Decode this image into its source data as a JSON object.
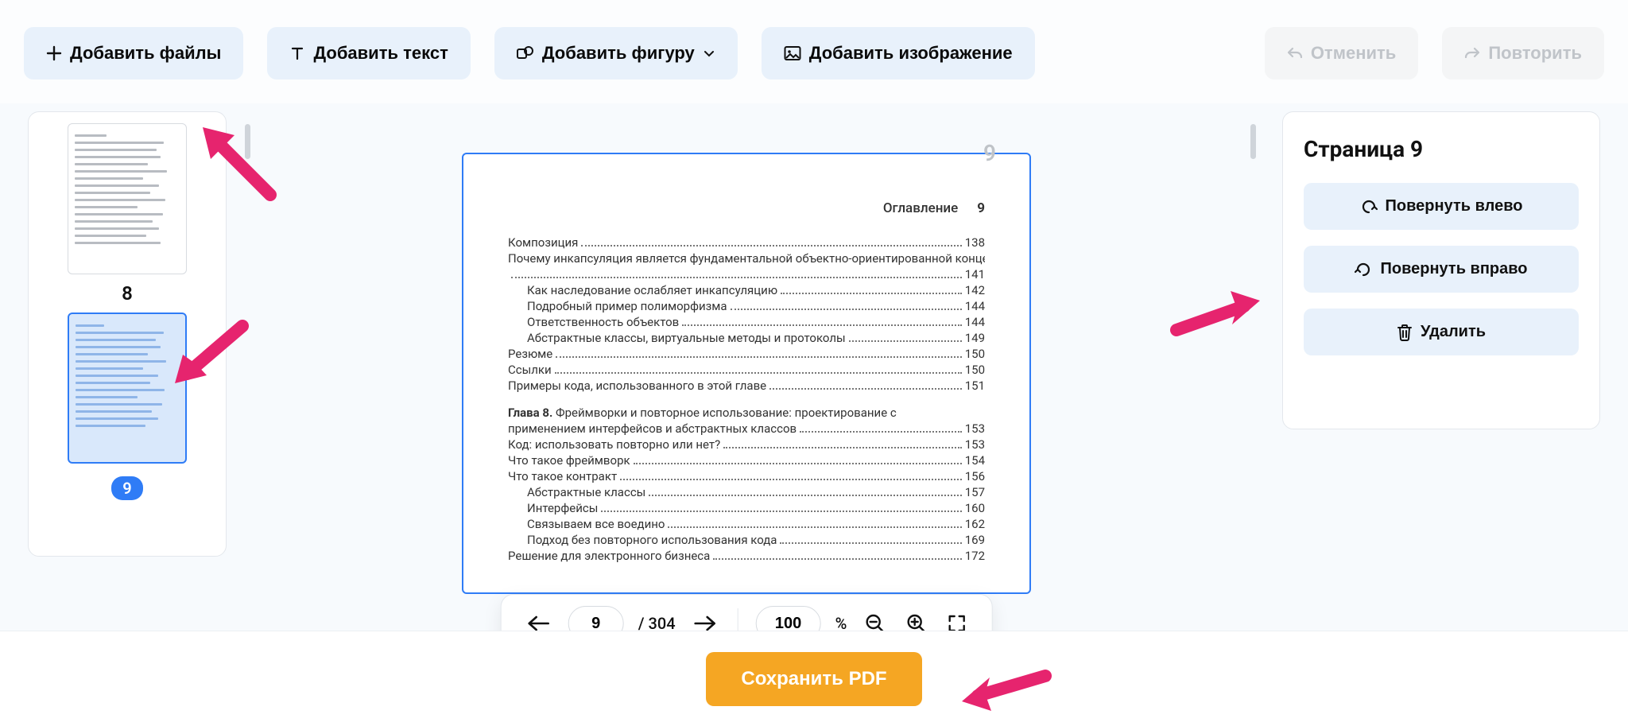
{
  "toolbar": {
    "add_files": "Добавить файлы",
    "add_text": "Добавить текст",
    "add_shape": "Добавить фигуру",
    "add_image": "Добавить изображение",
    "undo": "Отменить",
    "redo": "Повторить"
  },
  "thumbs": [
    {
      "page": "8",
      "selected": false
    },
    {
      "page": "9",
      "selected": true
    }
  ],
  "canvas": {
    "floating_page_number": "9",
    "header_label": "Оглавление",
    "header_page": "9",
    "toc": [
      {
        "title": "Композиция",
        "page": "138",
        "indent": 0
      },
      {
        "title": "Почему инкапсуляция является фундаментальной объектно-ориентированной концепцией",
        "page": "141",
        "indent": 0,
        "wrap": true
      },
      {
        "title": "Как наследование ослабляет инкапсуляцию",
        "page": "142",
        "indent": 1
      },
      {
        "title": "Подробный пример полиморфизма",
        "page": "144",
        "indent": 1
      },
      {
        "title": "Ответственность объектов",
        "page": "144",
        "indent": 1
      },
      {
        "title": "Абстрактные классы, виртуальные методы и протоколы",
        "page": "149",
        "indent": 1
      },
      {
        "title": "Резюме",
        "page": "150",
        "indent": 0
      },
      {
        "title": "Ссылки",
        "page": "150",
        "indent": 0
      },
      {
        "title": "Примеры кода, использованного в этой главе",
        "page": "151",
        "indent": 0
      }
    ],
    "chapter": {
      "prefix": "Глава 8.",
      "title": "Фреймворки и повторное использование: проектирование с применением интерфейсов и абстрактных классов",
      "page": "153"
    },
    "toc2": [
      {
        "title": "Код: использовать повторно или нет?",
        "page": "153",
        "indent": 0
      },
      {
        "title": "Что такое фреймворк",
        "page": "154",
        "indent": 0
      },
      {
        "title": "Что такое контракт",
        "page": "156",
        "indent": 0
      },
      {
        "title": "Абстрактные классы",
        "page": "157",
        "indent": 1
      },
      {
        "title": "Интерфейсы",
        "page": "160",
        "indent": 1
      },
      {
        "title": "Связываем все воедино",
        "page": "162",
        "indent": 1
      },
      {
        "title": "Подход без повторного использования кода",
        "page": "169",
        "indent": 1
      },
      {
        "title": "Решение для электронного бизнеса",
        "page": "172",
        "indent": 0
      }
    ]
  },
  "pager": {
    "current": "9",
    "total": "304",
    "zoom": "100",
    "zoom_unit": "%"
  },
  "actions": {
    "title": "Страница 9",
    "rotate_left": "Повернуть влево",
    "rotate_right": "Повернуть вправо",
    "delete": "Удалить"
  },
  "save": {
    "label": "Сохранить PDF"
  }
}
